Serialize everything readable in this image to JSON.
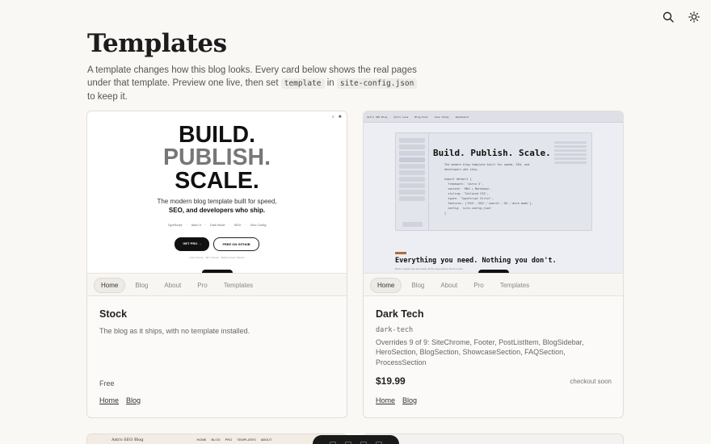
{
  "header": {
    "search_icon": "search-icon",
    "theme_icon": "sun-icon"
  },
  "page": {
    "title": "Templates",
    "intro_part1": "A template changes how this blog looks. Every card below shows the real pages under that template. Preview one live, then set",
    "intro_code1": "template",
    "intro_part2": "in",
    "intro_code2": "site-config.json",
    "intro_part3": "to keep it."
  },
  "cards": [
    {
      "preview": {
        "line1": "BUILD.",
        "line2": "PUBLISH.",
        "line3": "SCALE.",
        "sub1": "The modern blog template built for speed,",
        "sub2": "SEO, and developers who ship.",
        "features": [
          "TypeScript",
          "Astro 5",
          "Dark Mode",
          "MDX",
          "Zero Config"
        ],
        "btn_primary": "GET PRO →",
        "btn_secondary": "FREE ON GITHUB",
        "fine": "Open Source · MIT License · Built by Kevin Salinas"
      },
      "nav": [
        "Home",
        "Blog",
        "About",
        "Pro",
        "Templates"
      ],
      "name": "Stock",
      "description": "The blog as it ships, with no template installed.",
      "price": "Free",
      "links": [
        "Home",
        "Blog"
      ]
    },
    {
      "preview": {
        "tabs": [
          "Astro SEO Blog",
          "Astro Lens",
          "Blog Post",
          "Case Study",
          "Dashboard"
        ],
        "headline": "Build. Publish. Scale.",
        "code_lines": "The modern blog template built for speed, SEO, and\ndevelopers who ship.\n\nexport default {\n  framework: 'Astro 5',\n  content: 'MDX + Markdown',\n  styling: 'Tailwind CSS',\n  types: 'TypeScript Strict',\n  features: ['RSS','SEO','search','OG','dark mode'],\n  config: 'site-config.json'\n}",
        "bottom": "Everything you need. Nothing you don't.",
        "tiny": "Built to feature fast and ready. All the dependency list for a Unit."
      },
      "nav": [
        "Home",
        "Blog",
        "About",
        "Pro",
        "Templates"
      ],
      "name": "Dark Tech",
      "slug": "dark-tech",
      "overrides": "Overrides 9 of 9: SiteChrome, Footer, PostListItem, BlogSidebar, HeroSection, BlogSection, ShowcaseSection, FAQSection, ProcessSection",
      "price": "$19.99",
      "status": "checkout soon",
      "links": [
        "Home",
        "Blog"
      ]
    }
  ],
  "next_row": {
    "left_brand": "Astro SEO Blog",
    "left_nav": [
      "HOME",
      "BLOG",
      "PRO",
      "TEMPLATES",
      "ABOUT"
    ]
  }
}
